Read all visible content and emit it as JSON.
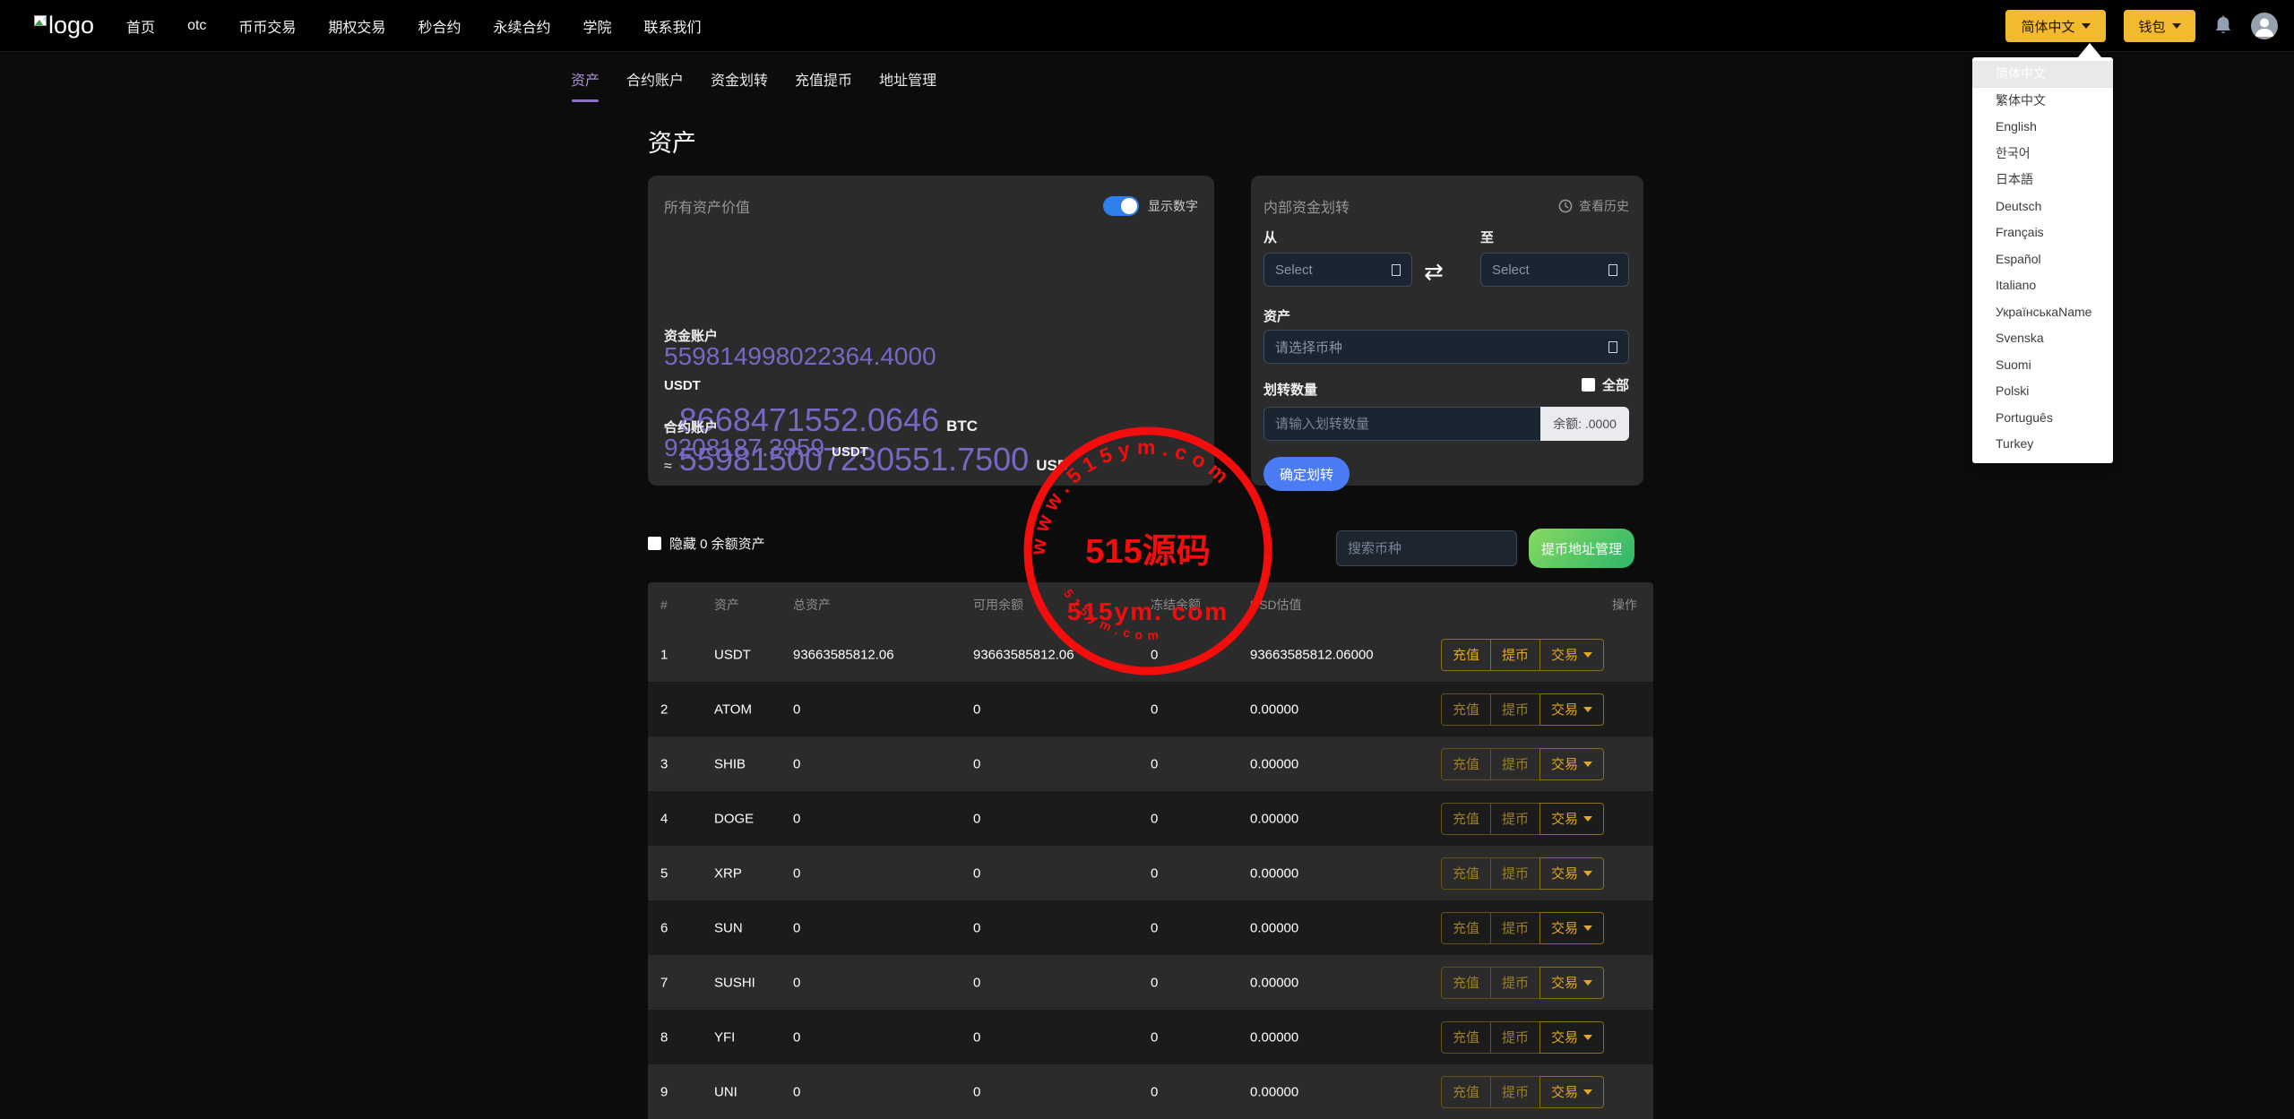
{
  "navbar": {
    "logo_text": "logo",
    "items": [
      "首页",
      "otc",
      "币币交易",
      "期权交易",
      "秒合约",
      "永续合约",
      "学院",
      "联系我们"
    ],
    "language_button": "简体中文",
    "wallet_button": "钱包"
  },
  "language_menu": {
    "selected": "简体中文",
    "items": [
      "简体中文",
      "繁体中文",
      "English",
      "한국어",
      "日本語",
      "Deutsch",
      "Français",
      "Español",
      "Italiano",
      "УкраїнськаName",
      "Svenska",
      "Suomi",
      "Polski",
      "Português",
      "Turkey"
    ]
  },
  "subnav": {
    "active": "资产",
    "items": [
      "资产",
      "合约账户",
      "资金划转",
      "充值提币",
      "地址管理"
    ]
  },
  "page": {
    "title": "资产"
  },
  "assets_card": {
    "title": "所有资产价值",
    "toggle_label": "显示数字",
    "approx_sign": "≈",
    "btc_value": "8668471552.0646",
    "btc_unit": "BTC",
    "usd_value": "559815007230551.7500",
    "usd_unit": "USD",
    "funding_label": "资金账户",
    "funding_value": "559814998022364.4000",
    "funding_unit": "USDT",
    "contract_label": "合约账户",
    "contract_value": "9208187.3959",
    "contract_unit": "USDT"
  },
  "transfer_card": {
    "title": "内部资金划转",
    "history_label": "查看历史",
    "from_label": "从",
    "to_label": "至",
    "select_placeholder": "Select",
    "asset_label": "资产",
    "asset_placeholder": "请选择币种",
    "amount_label": "划转数量",
    "all_label": "全部",
    "amount_placeholder": "请输入划转数量",
    "balance_addon": "余额: .0000",
    "submit_label": "确定划转"
  },
  "filter_row": {
    "hide_zero_label": "隐藏 0 余额资产",
    "search_placeholder": "搜索币种",
    "address_btn": "提币地址管理"
  },
  "table": {
    "headers": [
      "#",
      "资产",
      "总资产",
      "可用余额",
      "冻结余额",
      "USD估值",
      "操作"
    ],
    "actions": {
      "deposit": "充值",
      "withdraw": "提币",
      "trade": "交易"
    },
    "rows": [
      {
        "index": "1",
        "asset": "USDT",
        "total": "93663585812.06",
        "available": "93663585812.06",
        "frozen": "0",
        "usd": "93663585812.06000",
        "dim": false
      },
      {
        "index": "2",
        "asset": "ATOM",
        "total": "0",
        "available": "0",
        "frozen": "0",
        "usd": "0.00000",
        "dim": true
      },
      {
        "index": "3",
        "asset": "SHIB",
        "total": "0",
        "available": "0",
        "frozen": "0",
        "usd": "0.00000",
        "dim": true
      },
      {
        "index": "4",
        "asset": "DOGE",
        "total": "0",
        "available": "0",
        "frozen": "0",
        "usd": "0.00000",
        "dim": true
      },
      {
        "index": "5",
        "asset": "XRP",
        "total": "0",
        "available": "0",
        "frozen": "0",
        "usd": "0.00000",
        "dim": true
      },
      {
        "index": "6",
        "asset": "SUN",
        "total": "0",
        "available": "0",
        "frozen": "0",
        "usd": "0.00000",
        "dim": true
      },
      {
        "index": "7",
        "asset": "SUSHI",
        "total": "0",
        "available": "0",
        "frozen": "0",
        "usd": "0.00000",
        "dim": true
      },
      {
        "index": "8",
        "asset": "YFI",
        "total": "0",
        "available": "0",
        "frozen": "0",
        "usd": "0.00000",
        "dim": true
      },
      {
        "index": "9",
        "asset": "UNI",
        "total": "0",
        "available": "0",
        "frozen": "0",
        "usd": "0.00000",
        "dim": true
      }
    ]
  },
  "watermark": {
    "arc_top": "www.515ym.com",
    "center": "515源码",
    "line2": "515ym. com",
    "arc_bottom": "515ym.com",
    "color": "#f30d0d"
  },
  "colors": {
    "accent_purple": "#7569c4",
    "brand_yellow": "#f3ba2f",
    "toggle_blue": "#2f80ed",
    "submit_blue": "#4b7bf5",
    "green_button": "#2db56a",
    "gold_button": "#e3a821",
    "card_bg": "#2b2b2b",
    "row_dark": "#1b1b1b"
  }
}
